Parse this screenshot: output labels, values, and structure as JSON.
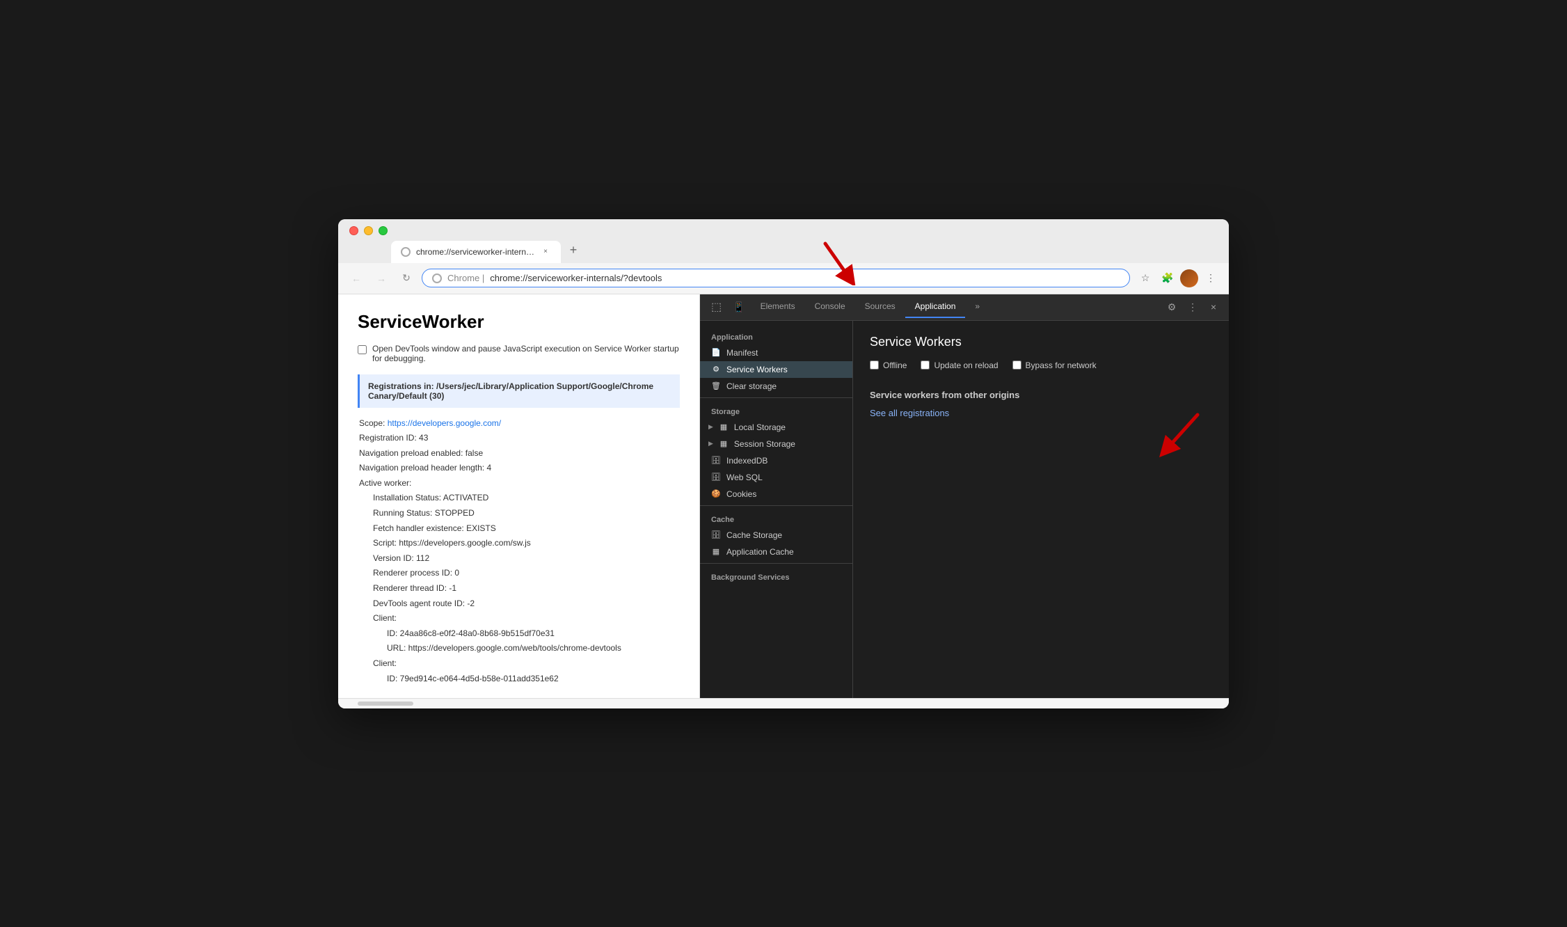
{
  "browser": {
    "tab": {
      "favicon_label": "globe",
      "title": "chrome://serviceworker-intern…",
      "close_label": "×"
    },
    "new_tab_label": "+",
    "nav": {
      "back_label": "←",
      "forward_label": "→",
      "refresh_label": "↻",
      "address": {
        "domain": "Chrome  |",
        "path": "chrome://serviceworker-internals/?devtools"
      },
      "star_label": "☆",
      "extensions_label": "🧩",
      "menu_label": "⋮"
    }
  },
  "page": {
    "title": "ServiceWorker",
    "checkbox_label": "Open DevTools window and pause JavaScript execution on Service Worker startup for debugging.",
    "registration_header": "Registrations in: /Users/jec/Library/Application Support/Google/Chrome Canary/Default (30)",
    "scope_label": "Scope:",
    "scope_url": "https://developers.google.com/",
    "details": [
      "Registration ID: 43",
      "Navigation preload enabled: false",
      "Navigation preload header length: 4",
      "Active worker:",
      "    Installation Status: ACTIVATED",
      "    Running Status: STOPPED",
      "    Fetch handler existence: EXISTS",
      "    Script: https://developers.google.com/sw.js",
      "    Version ID: 112",
      "    Renderer process ID: 0",
      "    Renderer thread ID: -1",
      "    DevTools agent route ID: -2",
      "    Client:",
      "        ID: 24aa86c8-e0f2-48a0-8b68-9b515df70e31",
      "        URL: https://developers.google.com/web/tools/chrome-devtools",
      "    Client:",
      "        ID: 79ed914c-e064-4d5d-b58e-011add351e62"
    ]
  },
  "devtools": {
    "tabs": [
      {
        "id": "elements",
        "label": "Elements",
        "active": false
      },
      {
        "id": "console",
        "label": "Console",
        "active": false
      },
      {
        "id": "sources",
        "label": "Sources",
        "active": false
      },
      {
        "id": "application",
        "label": "Application",
        "active": true
      }
    ],
    "overflow_label": "»",
    "settings_label": "⚙",
    "more_label": "⋮",
    "close_label": "×",
    "sidebar": {
      "application_section": "Application",
      "items_application": [
        {
          "id": "manifest",
          "icon": "📄",
          "label": "Manifest",
          "active": false
        },
        {
          "id": "service-workers",
          "icon": "⚙",
          "label": "Service Workers",
          "active": true
        },
        {
          "id": "clear-storage",
          "icon": "🗑",
          "label": "Clear storage",
          "active": false
        }
      ],
      "storage_section": "Storage",
      "items_storage": [
        {
          "id": "local-storage",
          "icon": "▶",
          "label": "Local Storage",
          "has_arrow": true
        },
        {
          "id": "session-storage",
          "icon": "▶",
          "label": "Session Storage",
          "has_arrow": true
        },
        {
          "id": "indexeddb",
          "icon": "🗄",
          "label": "IndexedDB"
        },
        {
          "id": "web-sql",
          "icon": "🗄",
          "label": "Web SQL"
        },
        {
          "id": "cookies",
          "icon": "🍪",
          "label": "Cookies"
        }
      ],
      "cache_section": "Cache",
      "items_cache": [
        {
          "id": "cache-storage",
          "icon": "🗄",
          "label": "Cache Storage"
        },
        {
          "id": "application-cache",
          "icon": "▦",
          "label": "Application Cache"
        }
      ],
      "background_section": "Background Services"
    },
    "main": {
      "title": "Service Workers",
      "options": [
        {
          "id": "offline",
          "label": "Offline"
        },
        {
          "id": "update-on-reload",
          "label": "Update on reload"
        },
        {
          "id": "bypass-for-network",
          "label": "Bypass for network"
        }
      ],
      "other_origins_title": "Service workers from other origins",
      "see_all_label": "See all registrations"
    }
  },
  "annotations": {
    "nav_arrow": "↙",
    "panel_arrow": "↙"
  }
}
